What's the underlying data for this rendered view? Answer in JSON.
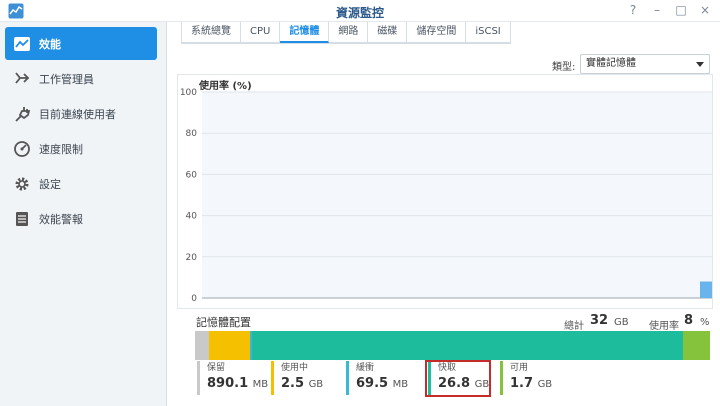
{
  "window": {
    "title": "資源監控",
    "buttons": [
      "?",
      "–",
      "□",
      "×"
    ]
  },
  "sidebar": {
    "items": [
      {
        "label": "效能",
        "icon": "performance-chart-icon",
        "active": true
      },
      {
        "label": "工作管理員",
        "icon": "task-manager-icon",
        "active": false
      },
      {
        "label": "目前連線使用者",
        "icon": "plug-icon",
        "active": false
      },
      {
        "label": "速度限制",
        "icon": "speedometer-icon",
        "active": false
      },
      {
        "label": "設定",
        "icon": "gear-icon",
        "active": false
      },
      {
        "label": "效能警報",
        "icon": "report-list-icon",
        "active": false
      }
    ]
  },
  "tabs": [
    {
      "label": "系統總覽",
      "active": false
    },
    {
      "label": "CPU",
      "active": false
    },
    {
      "label": "記憶體",
      "active": true
    },
    {
      "label": "網路",
      "active": false
    },
    {
      "label": "磁碟",
      "active": false
    },
    {
      "label": "儲存空間",
      "active": false
    },
    {
      "label": "iSCSI",
      "active": false
    }
  ],
  "type_filter": {
    "label": "類型:",
    "value": "實體記憶體"
  },
  "chart_data": {
    "type": "bar",
    "ylabel": "使用率 (%)",
    "ylim": [
      0,
      100
    ],
    "yticks": [
      "0",
      "20",
      "40",
      "60",
      "80",
      "100"
    ],
    "grid": true,
    "series": [
      {
        "values": [
          8
        ]
      }
    ],
    "color": "#6ab4ee"
  },
  "memory": {
    "title": "記憶體配置",
    "total_label": "總計",
    "total_value": "32",
    "total_unit": "GB",
    "usage_label": "使用率",
    "usage_value": "8",
    "usage_unit": "%",
    "segments": [
      {
        "name": "保留",
        "value": "890.1",
        "unit": "MB",
        "color": "#c9c9c9",
        "fraction": 0.028
      },
      {
        "name": "使用中",
        "value": "2.5",
        "unit": "GB",
        "color": "#f5c000",
        "fraction": 0.078
      },
      {
        "name": "緩衝",
        "value": "69.5",
        "unit": "MB",
        "color": "#3bb8d4",
        "fraction": 0.004
      },
      {
        "name": "快取",
        "value": "26.8",
        "unit": "GB",
        "color": "#1cbc9c",
        "fraction": 0.837
      },
      {
        "name": "可用",
        "value": "1.7",
        "unit": "GB",
        "color": "#86c33d",
        "fraction": 0.053
      }
    ]
  }
}
